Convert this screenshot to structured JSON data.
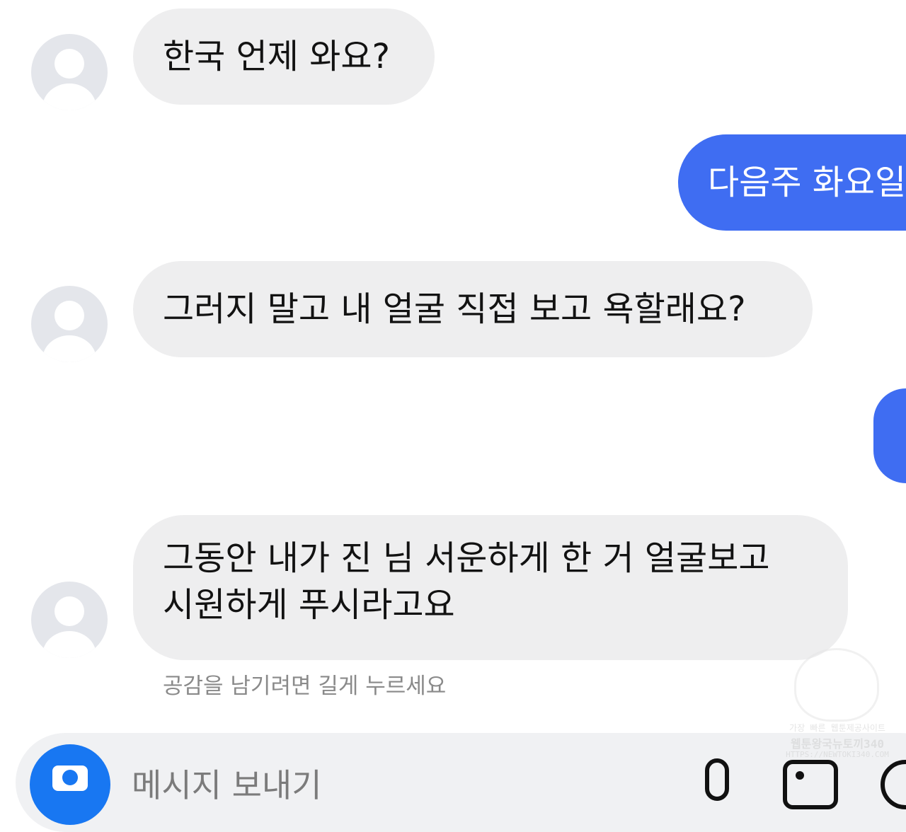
{
  "messages": [
    {
      "direction": "incoming",
      "text": "한국 언제 와요?"
    },
    {
      "direction": "outgoing",
      "text": "다음주 화요일"
    },
    {
      "direction": "incoming",
      "text": "그러지 말고 내 얼굴 직접 보고 욕할래요?"
    },
    {
      "direction": "outgoing",
      "text": ""
    },
    {
      "direction": "incoming",
      "lines": [
        "그동안 내가 진 님 서운하게 한 거 얼굴보고",
        "시원하게 푸시라고요"
      ]
    }
  ],
  "reaction_hint": "공감을 남기려면 길게 누르세요",
  "composer": {
    "placeholder": "메시지 보내기",
    "icons": [
      "camera-icon",
      "microphone-icon",
      "image-icon",
      "sticker-icon"
    ]
  },
  "watermark": {
    "line1": "가장 빠른 웹툰제공사이트",
    "line2": "웹툰왕국뉴토끼340",
    "line3": "HTTPS://NEWTOKI340.COM"
  },
  "colors": {
    "incoming_bubble": "#eeeeef",
    "outgoing_bubble": "#3f6df2",
    "camera_button": "#1877f2"
  }
}
